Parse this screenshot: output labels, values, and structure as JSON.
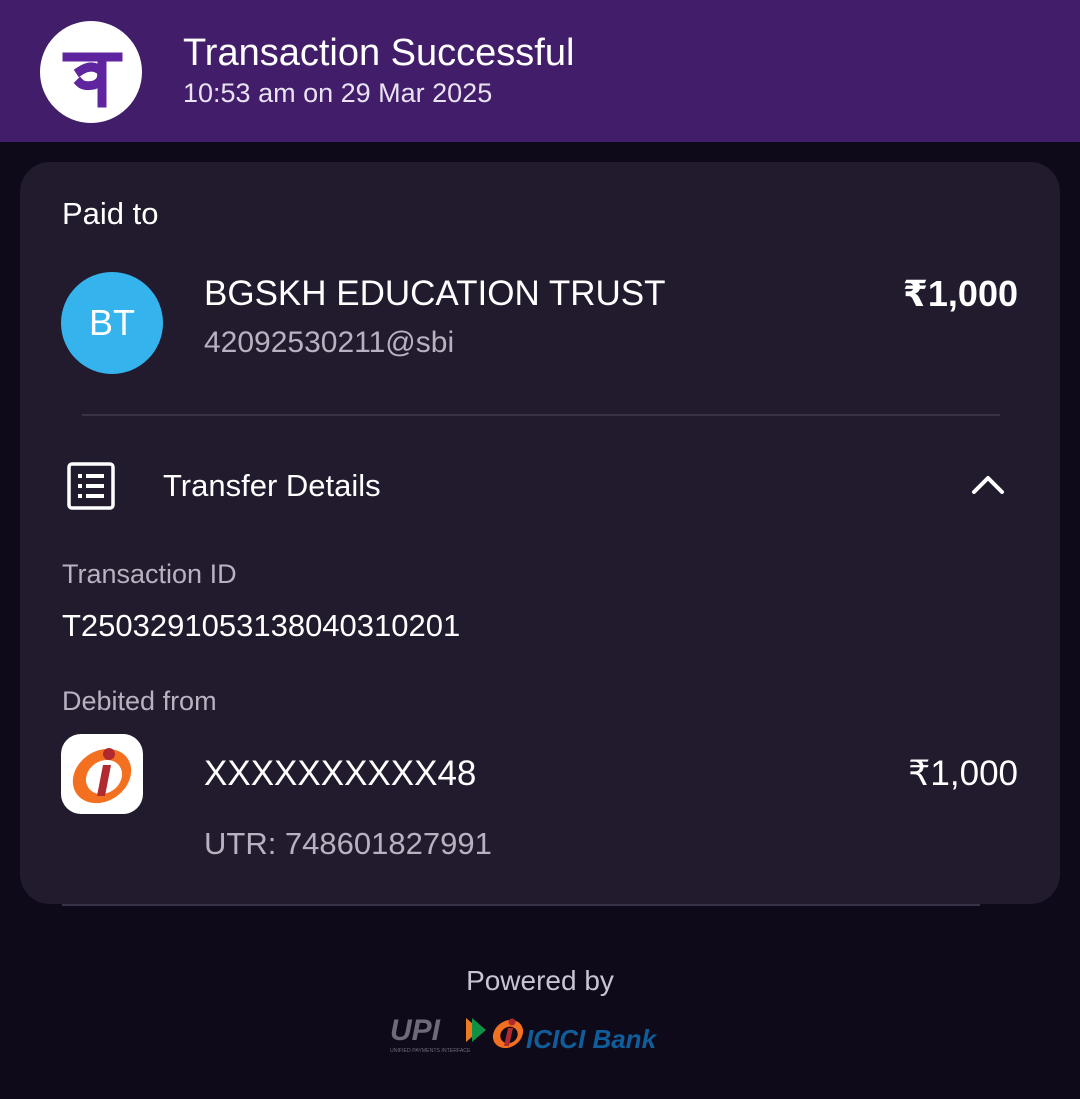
{
  "header": {
    "logo_icon": "phonepe-logo-icon",
    "title": "Transaction Successful",
    "subtitle": "10:53 am on 29 Mar 2025",
    "background": "#421e6a"
  },
  "card": {
    "paid_to_label": "Paid to",
    "payee": {
      "initials": "BT",
      "name": "BGSKH EDUCATION TRUST",
      "upi_id": "42092530211@sbi",
      "amount": "₹1,000",
      "avatar_color": "#34b3ec"
    },
    "transfer_details": {
      "icon": "receipt-list-icon",
      "label": "Transfer Details",
      "toggle_icon": "chevron-up-icon",
      "transaction_id_label": "Transaction ID",
      "transaction_id": "T2503291053138040310201",
      "debited_from_label": "Debited from",
      "bank_icon": "icici-bank-icon",
      "account_number": "XXXXXXXXXX48",
      "debit_amount": "₹1,000",
      "utr": "UTR: 748601827991"
    }
  },
  "footer": {
    "powered_by": "Powered by",
    "upi_logo_text": "UPI",
    "upi_tagline": "UNIFIED PAYMENTS INTERFACE",
    "bank_logo_text": "ICICI Bank"
  }
}
